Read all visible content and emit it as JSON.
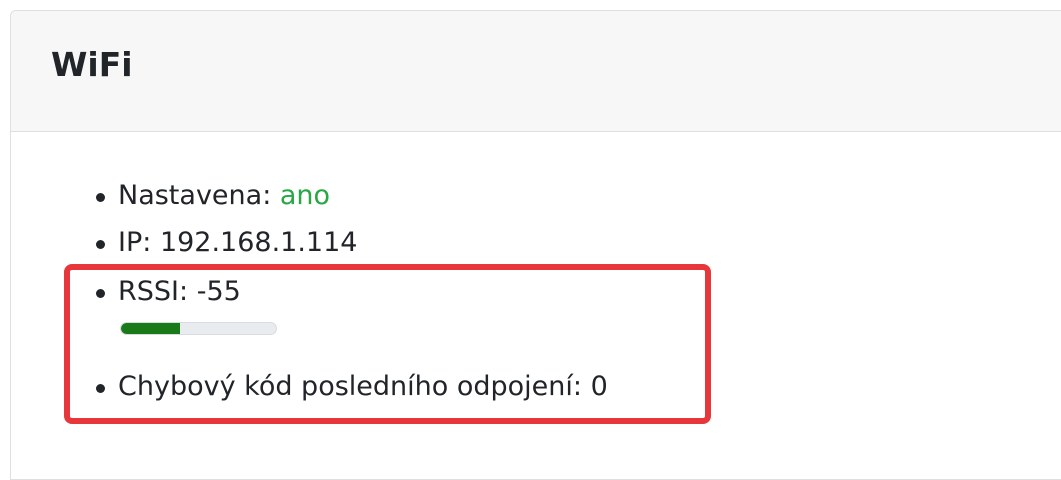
{
  "card": {
    "title": "WiFi"
  },
  "status": {
    "configured_label": "Nastavena:",
    "configured_value": "ano",
    "ip_label": "IP:",
    "ip_value": "192.168.1.114",
    "rssi_label": "RSSI:",
    "rssi_value": "-55",
    "signal_level_fraction": 0.38,
    "error_label": "Chybový kód posledního odpojení:",
    "error_value": "0"
  },
  "colors": {
    "ok_value": "#28a745",
    "signal_bar": "#1a7a1a",
    "highlight_border": "#e8373a"
  }
}
